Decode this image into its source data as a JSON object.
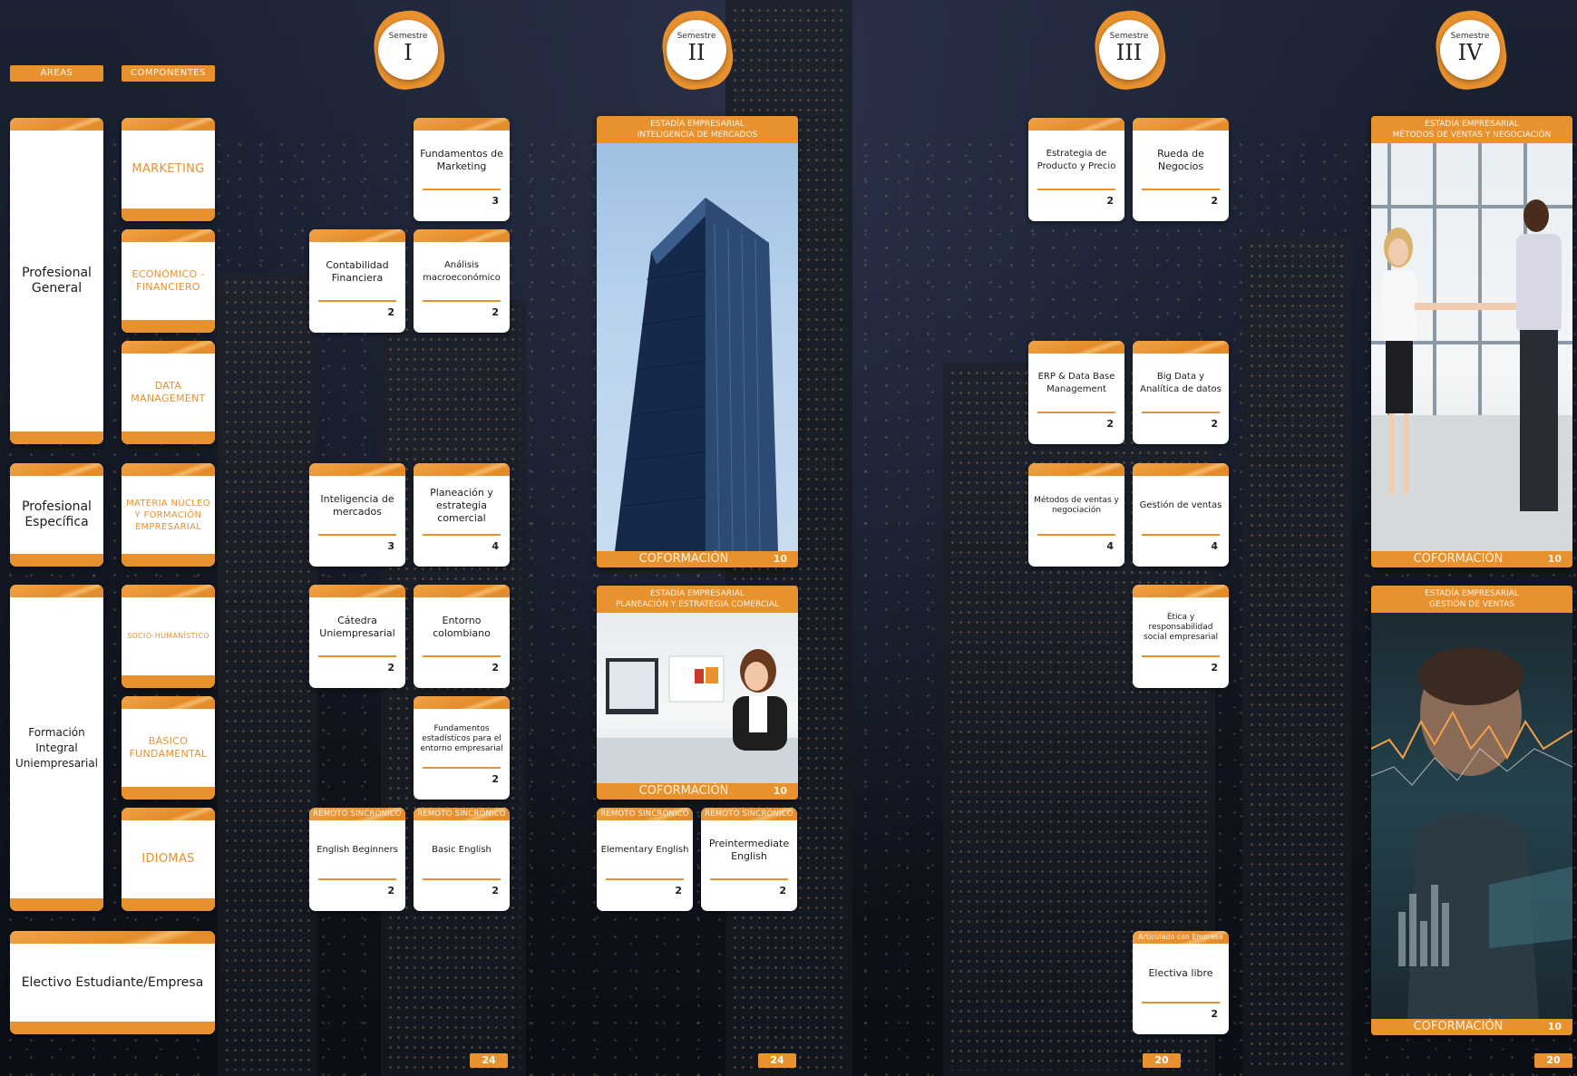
{
  "headers": {
    "areas": "ÁREAS",
    "components": "COMPONENTES"
  },
  "semesters": [
    {
      "label": "Semestre",
      "numeral": "I"
    },
    {
      "label": "Semestre",
      "numeral": "II"
    },
    {
      "label": "Semestre",
      "numeral": "III"
    },
    {
      "label": "Semestre",
      "numeral": "IV"
    }
  ],
  "areas": [
    {
      "name": "Profesional General"
    },
    {
      "name": "Profesional Específica"
    },
    {
      "name": "Formación Integral Uniempresarial"
    },
    {
      "name": "Electivo Estudiante/Empresa"
    }
  ],
  "components": [
    {
      "name": "MARKETING"
    },
    {
      "name": "ECONÓMICO - FINANCIERO"
    },
    {
      "name": "DATA MANAGEMENT"
    },
    {
      "name": "MATERIA NÚCLEO Y FORMACIÓN EMPRESARIAL"
    },
    {
      "name": "SOCIO-HUMANÍSTICO"
    },
    {
      "name": "BÁSICO FUNDAMENTAL"
    },
    {
      "name": "IDIOMAS"
    }
  ],
  "sem1": {
    "courses": [
      {
        "name": "Fundamentos de Marketing",
        "credits": "3"
      },
      {
        "name": "Contabilidad Financiera",
        "credits": "2"
      },
      {
        "name": "Análisis macroeconómico",
        "credits": "2"
      },
      {
        "name": "Inteligencia de mercados",
        "credits": "3"
      },
      {
        "name": "Planeación y estrategia comercial",
        "credits": "4"
      },
      {
        "name": "Cátedra Uniempresarial",
        "credits": "2"
      },
      {
        "name": "Entorno colombiano",
        "credits": "2"
      },
      {
        "name": "Fundamentos estadísticos para el entorno empresarial",
        "credits": "2"
      },
      {
        "tag": "REMOTO SINCRÓNICO",
        "name": "English Beginners",
        "credits": "2"
      },
      {
        "tag": "REMOTO SINCRÓNICO",
        "name": "Basic English",
        "credits": "2"
      }
    ],
    "total": "24"
  },
  "sem2": {
    "panel1": {
      "title1": "ESTADÍA EMPRESARIAL",
      "title2": "INTELIGENCIA DE MERCADOS",
      "label": "COFORMACIÓN",
      "credits": "10"
    },
    "panel2": {
      "title1": "ESTADÍA EMPRESARIAL",
      "title2": "PLANEACIÓN Y ESTRATEGIA COMERCIAL",
      "label": "COFORMACIÓN",
      "credits": "10"
    },
    "courses": [
      {
        "tag": "REMOTO SINCRÓNICO",
        "name": "Elementary English",
        "credits": "2"
      },
      {
        "tag": "REMOTO SINCRÓNICO",
        "name": "Preintermediate English",
        "credits": "2"
      }
    ],
    "total": "24"
  },
  "sem3": {
    "courses": [
      {
        "name": "Estrategia de Producto y Precio",
        "credits": "2"
      },
      {
        "name": "Rueda de Negocios",
        "credits": "2"
      },
      {
        "name": "ERP & Data Base Management",
        "credits": "2"
      },
      {
        "name": "Big Data y Analítica de datos",
        "credits": "2"
      },
      {
        "name": "Métodos de ventas y negociación",
        "credits": "4"
      },
      {
        "name": "Gestión de ventas",
        "credits": "4"
      },
      {
        "name": "Ética y responsabilidad social empresarial",
        "credits": "2"
      },
      {
        "tag": "Articulado con Empresa",
        "name": "Electiva libre",
        "credits": "2"
      }
    ],
    "total": "20"
  },
  "sem4": {
    "panel1": {
      "title1": "ESTADÍA EMPRESARIAL",
      "title2": "MÉTODOS DE VENTAS Y NEGOCIACIÓN",
      "label": "COFORMACIÓN",
      "credits": "10"
    },
    "panel2": {
      "title1": "ESTADÍA EMPRESARIAL",
      "title2": "GESTIÓN DE VENTAS",
      "label": "COFORMACIÓN",
      "credits": "10"
    },
    "total": "20"
  },
  "colors": {
    "accent": "#e8912f",
    "card": "#ffffff",
    "background": "#141a27"
  }
}
